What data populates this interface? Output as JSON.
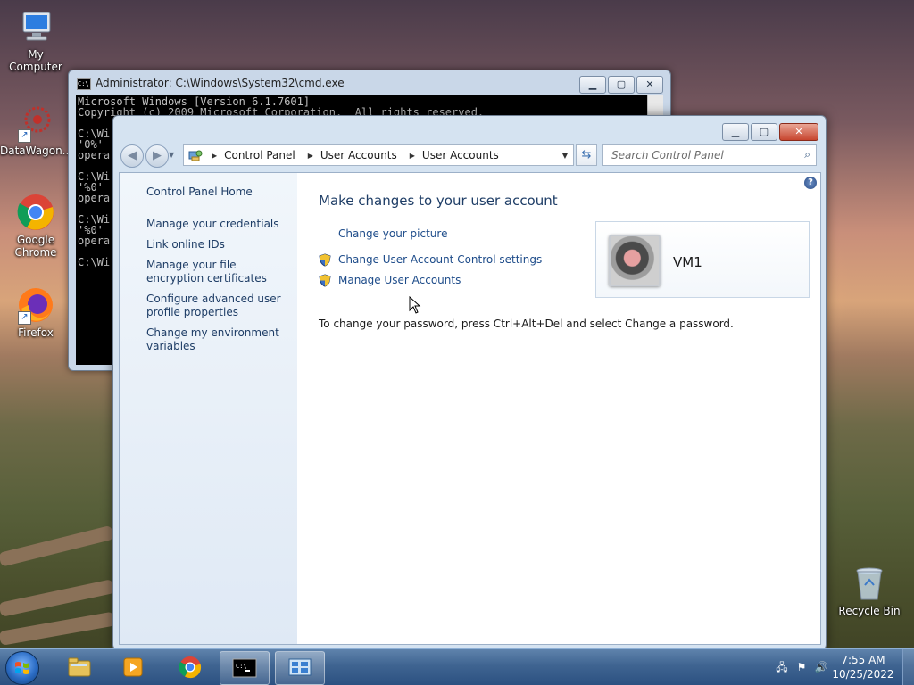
{
  "desktop": {
    "icons": [
      {
        "label": "My Computer"
      },
      {
        "label": "DataWagon..."
      },
      {
        "label": "Google Chrome"
      },
      {
        "label": "Firefox"
      },
      {
        "label": "Recycle Bin"
      }
    ]
  },
  "cmd_window": {
    "title": "Administrator: C:\\Windows\\System32\\cmd.exe",
    "lines": [
      "Microsoft Windows [Version 6.1.7601]",
      "Copyright (c) 2009 Microsoft Corporation.  All rights reserved.",
      "",
      "C:\\Wi",
      "'0%'",
      "opera",
      "",
      "C:\\Wi",
      "'%0'",
      "opera",
      "",
      "C:\\Wi",
      "'%0'",
      "opera",
      "",
      "C:\\Wi"
    ]
  },
  "control_panel": {
    "breadcrumb": [
      "Control Panel",
      "User Accounts",
      "User Accounts"
    ],
    "search_placeholder": "Search Control Panel",
    "left_links": [
      "Control Panel Home",
      "Manage your credentials",
      "Link online IDs",
      "Manage your file encryption certificates",
      "Configure advanced user profile properties",
      "Change my environment variables"
    ],
    "heading": "Make changes to your user account",
    "tasks": {
      "change_picture": "Change your picture",
      "uac": "Change User Account Control settings",
      "manage": "Manage User Accounts"
    },
    "password_note": "To change your password, press Ctrl+Alt+Del and select Change a password.",
    "user_name": "VM1",
    "help_glyph": "?"
  },
  "taskbar": {
    "time": "7:55 AM",
    "date": "10/25/2022"
  },
  "colors": {
    "link": "#1e4c8a",
    "heading": "#1e3d66",
    "taskbar": "#3f6491"
  }
}
